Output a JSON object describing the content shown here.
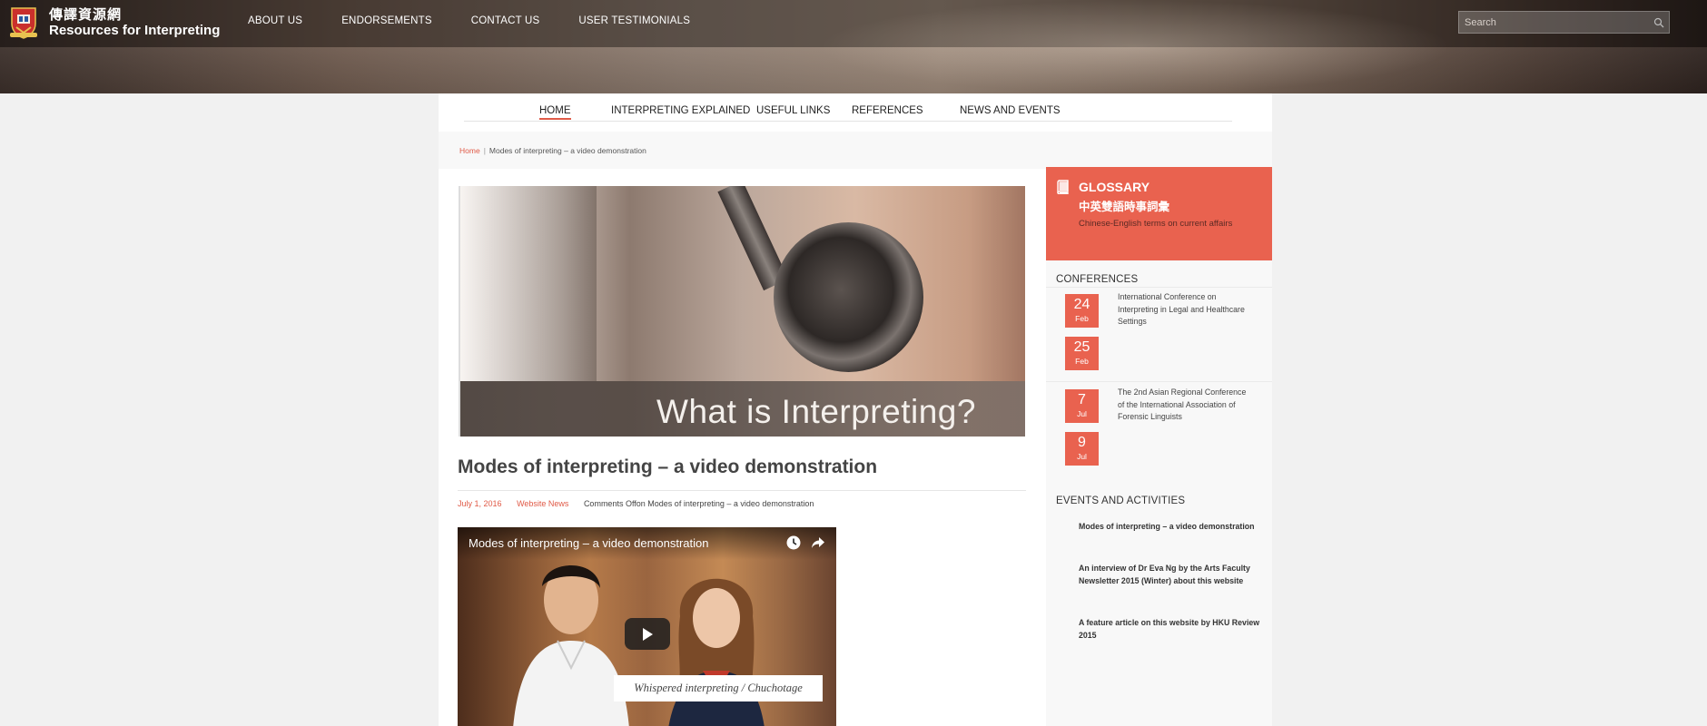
{
  "header": {
    "logo_cn": "傳譯資源網",
    "logo_en": "Resources for Interpreting",
    "nav": [
      "ABOUT US",
      "ENDORSEMENTS",
      "CONTACT US",
      "USER TESTIMONIALS"
    ],
    "search_placeholder": "Search"
  },
  "subnav": {
    "items": [
      "HOME",
      "INTERPRETING EXPLAINED",
      "USEFUL LINKS",
      "REFERENCES",
      "NEWS AND EVENTS"
    ],
    "active": "HOME"
  },
  "breadcrumb": {
    "home": "Home",
    "separator": "|",
    "current": "Modes of interpreting – a video demonstration"
  },
  "article": {
    "hero_text": "What is Interpreting?",
    "title": "Modes of interpreting – a video demonstration",
    "date": "July 1, 2016",
    "category": "Website News",
    "comments": "Comments Offon Modes of interpreting – a video demonstration",
    "video": {
      "title": "Modes of interpreting – a video demonstration",
      "caption": "Whispered interpreting / Chuchotage"
    }
  },
  "sidebar": {
    "glossary": {
      "title": "GLOSSARY",
      "cn": "中英雙語時事詞彙",
      "subtitle": "Chinese-English terms on current affairs"
    },
    "conferences_heading": "CONFERENCES",
    "conferences": [
      {
        "start_day": "24",
        "start_month": "Feb",
        "end_day": "25",
        "end_month": "Feb",
        "title": "International Conference on Interpreting in Legal and Healthcare Settings"
      },
      {
        "start_day": "7",
        "start_month": "Jul",
        "end_day": "9",
        "end_month": "Jul",
        "title": "The 2nd Asian Regional Conference of the International Association of Forensic Linguists"
      }
    ],
    "events_heading": "EVENTS AND ACTIVITIES",
    "events": [
      "Modes of interpreting – a video demonstration",
      "An interview of Dr Eva Ng by the Arts Faculty Newsletter 2015 (Winter) about this website",
      "A feature article on this website by HKU Review 2015"
    ]
  },
  "colors": {
    "accent": "#e9624f",
    "link": "#e05a47"
  },
  "icons": [
    "university-crest-icon",
    "search-icon",
    "book-icon",
    "clock-icon",
    "share-icon",
    "play-icon"
  ]
}
